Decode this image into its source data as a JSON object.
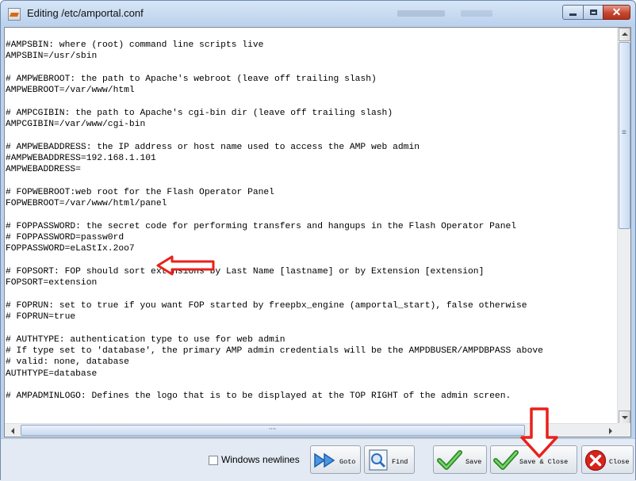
{
  "window": {
    "title": "Editing /etc/amportal.conf"
  },
  "editor": {
    "lines": [
      "#AMPSBIN: where (root) command line scripts live",
      "AMPSBIN=/usr/sbin",
      "",
      "# AMPWEBROOT: the path to Apache's webroot (leave off trailing slash)",
      "AMPWEBROOT=/var/www/html",
      "",
      "# AMPCGIBIN: the path to Apache's cgi-bin dir (leave off trailing slash)",
      "AMPCGIBIN=/var/www/cgi-bin",
      "",
      "# AMPWEBADDRESS: the IP address or host name used to access the AMP web admin",
      "#AMPWEBADDRESS=192.168.1.101",
      "AMPWEBADDRESS=",
      "",
      "# FOPWEBROOT:web root for the Flash Operator Panel",
      "FOPWEBROOT=/var/www/html/panel",
      "",
      "# FOPPASSWORD: the secret code for performing transfers and hangups in the Flash Operator Panel",
      "# FOPPASSWORD=passw0rd",
      "FOPPASSWORD=eLaStIx.2oo7",
      "",
      "# FOPSORT: FOP should sort extensions by Last Name [lastname] or by Extension [extension]",
      "FOPSORT=extension",
      "",
      "# FOPRUN: set to true if you want FOP started by freepbx_engine (amportal_start), false otherwise",
      "# FOPRUN=true",
      "",
      "# AUTHTYPE: authentication type to use for web admin",
      "# If type set to 'database', the primary AMP admin credentials will be the AMPDBUSER/AMPDBPASS above",
      "# valid: none, database",
      "AUTHTYPE=database",
      "",
      "# AMPADMINLOGO: Defines the logo that is to be displayed at the TOP RIGHT of the admin screen."
    ]
  },
  "toolbar": {
    "windows_newlines_label": "Windows newlines",
    "windows_newlines_checked": false,
    "goto_label": "Goto",
    "find_label": "Find",
    "save_label": "Save",
    "save_close_label": "Save & Close",
    "close_label": "Close"
  },
  "colors": {
    "annotation_arrow": "#e8211b",
    "goto_icon": "#2f7fd6",
    "save_check": "#35a12c",
    "close_icon": "#d8231c"
  },
  "icons": [
    "app-icon",
    "goto-arrow-icon",
    "find-magnifier-icon",
    "save-check-icon",
    "save-close-check-icon",
    "close-x-icon"
  ]
}
